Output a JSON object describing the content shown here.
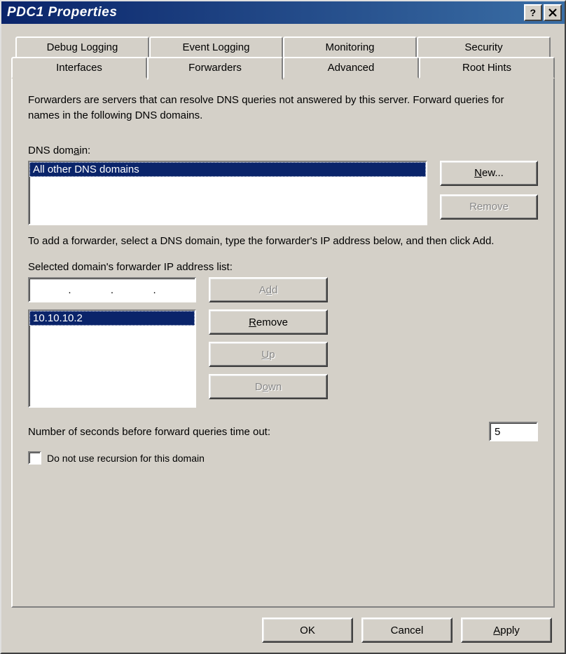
{
  "window": {
    "title": "PDC1 Properties"
  },
  "tabs": {
    "back": [
      "Debug Logging",
      "Event Logging",
      "Monitoring",
      "Security"
    ],
    "front": [
      "Interfaces",
      "Forwarders",
      "Advanced",
      "Root Hints"
    ],
    "active": "Forwarders"
  },
  "panel": {
    "description": "Forwarders are servers that can resolve DNS queries not answered by this server. Forward queries for names in the following DNS domains.",
    "dns_domain_label": "DNS domain:",
    "dns_domains": [
      "All other DNS domains"
    ],
    "new_btn": "New...",
    "new_btn_u": "N",
    "remove_domain_btn": "Remove",
    "instruction": "To add a forwarder, select a DNS domain, type the forwarder's IP address below, and then click Add.",
    "ip_list_label": "Selected domain's forwarder IP address list:",
    "ip_input": "",
    "add_btn": "Add",
    "add_btn_u": "d",
    "ip_list": [
      "10.10.10.2"
    ],
    "remove_ip_btn": "Remove",
    "remove_ip_btn_u": "R",
    "up_btn": "Up",
    "up_btn_u": "U",
    "down_btn": "Down",
    "down_btn_u": "o",
    "timeout_label": "Number of seconds before forward queries time out:",
    "timeout_value": "5",
    "recursion_label": "Do not use recursion for this domain",
    "recursion_checked": false
  },
  "buttons": {
    "ok": "OK",
    "cancel": "Cancel",
    "apply": "Apply",
    "apply_u": "A"
  }
}
